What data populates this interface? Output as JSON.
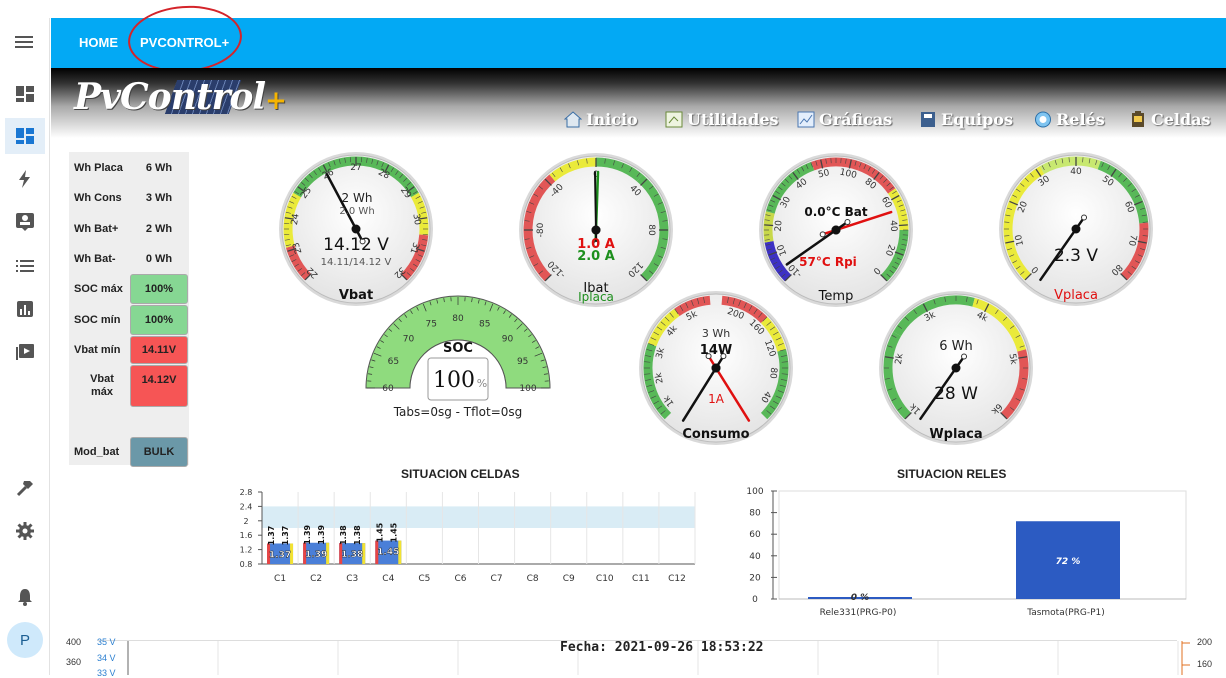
{
  "appbar": {
    "tabs": [
      {
        "label": "HOME"
      },
      {
        "label": "PVCONTROL+"
      }
    ]
  },
  "header": {
    "logo_text": "PvControl",
    "logo_plus": "+",
    "nav": [
      {
        "label": "Inicio",
        "icon": "home-icon"
      },
      {
        "label": "Utilidades",
        "icon": "utilities-icon"
      },
      {
        "label": "Gráficas",
        "icon": "charts-icon"
      },
      {
        "label": "Equipos",
        "icon": "equipment-icon"
      },
      {
        "label": "Relés",
        "icon": "relay-icon"
      },
      {
        "label": "Celdas",
        "icon": "cells-icon"
      }
    ]
  },
  "stats": [
    {
      "label": "Wh Placa",
      "value": "6 Wh"
    },
    {
      "label": "Wh Cons",
      "value": "3 Wh"
    },
    {
      "label": "Wh Bat+",
      "value": "2 Wh"
    },
    {
      "label": "Wh Bat-",
      "value": "0 Wh"
    },
    {
      "label": "SOC máx",
      "value": "100%",
      "color": "#86d793"
    },
    {
      "label": "SOC mín",
      "value": "100%",
      "color": "#86d793"
    },
    {
      "label": "Vbat mín",
      "value": "14.11V",
      "color": "#f65555"
    },
    {
      "label": "Vbat máx",
      "value": "14.12V",
      "color": "#f65555"
    },
    {
      "label": "Mod_bat",
      "value": "BULK",
      "color": "#6b98a8"
    }
  ],
  "gauges": {
    "vbat": {
      "title": "Vbat",
      "top": "2 Wh",
      "top2": "2.0 Wh",
      "value": "14.12 V",
      "sub": "14.11/14.12 V",
      "ticks": [
        "22",
        "23",
        "24",
        "25",
        "26",
        "27",
        "28",
        "29",
        "30",
        "31",
        "32"
      ]
    },
    "ibat": {
      "title": "Ibat",
      "title2": "Iplaca",
      "v1": "1.0 A",
      "v2": "2.0 A",
      "ticks": [
        "-120",
        "-80",
        "-40",
        "0",
        "40",
        "80",
        "120"
      ]
    },
    "temp": {
      "title": "Temp",
      "v1": "0.0°C Bat",
      "v2": "57°C Rpi",
      "ticks": [
        "-10",
        "10",
        "20",
        "30",
        "40",
        "50",
        "100",
        "80",
        "60",
        "40",
        "20",
        "0"
      ]
    },
    "vplaca": {
      "title": "Vplaca",
      "value": "2.3 V",
      "ticks": [
        "0",
        "10",
        "20",
        "30",
        "40",
        "50",
        "60",
        "70",
        "80"
      ]
    },
    "soc": {
      "title": "SOC",
      "value": "100",
      "unit": "%",
      "ticks": [
        "60",
        "65",
        "70",
        "75",
        "80",
        "85",
        "90",
        "95",
        "100"
      ],
      "footer": "Tabs=0sg - Tflot=0sg"
    },
    "consumo": {
      "title": "Consumo",
      "top": "3 Wh",
      "value": "14W",
      "v2": "1A",
      "ticks": [
        "1k",
        "2k",
        "3k",
        "4k",
        "5k",
        "200",
        "160",
        "120",
        "80",
        "40"
      ]
    },
    "wplaca": {
      "title": "Wplaca",
      "top": "6 Wh",
      "value": "28 W",
      "ticks": [
        "1k",
        "2k",
        "3k",
        "4k",
        "5k",
        "6k"
      ]
    }
  },
  "celdas": {
    "title": "SITUACION CELDAS",
    "chart_data": {
      "type": "bar",
      "categories": [
        "C1",
        "C2",
        "C3",
        "C4",
        "C5",
        "C6",
        "C7",
        "C8",
        "C9",
        "C10",
        "C11",
        "C12"
      ],
      "values": [
        1.37,
        1.39,
        1.38,
        1.45,
        null,
        null,
        null,
        null,
        null,
        null,
        null,
        null
      ],
      "max_labels": [
        "1.37",
        "1.37",
        "1.39",
        "1.39",
        "1.38",
        "1.38",
        "1.45",
        "1.45"
      ],
      "ylim": [
        0.8,
        2.8
      ],
      "yticks": [
        "2.8",
        "2.4",
        "2",
        "1.6",
        "1.2",
        "0.8"
      ],
      "band": [
        1.8,
        2.4
      ]
    }
  },
  "reles": {
    "title": "SITUACION RELES",
    "chart_data": {
      "type": "bar",
      "categories": [
        "Rele331(PRG-P0)",
        "Tasmota(PRG-P1)"
      ],
      "values": [
        0,
        72
      ],
      "labels": [
        "0 %",
        "72 %"
      ],
      "ylim": [
        0,
        100
      ],
      "yticks": [
        "100",
        "80",
        "60",
        "40",
        "20",
        "0"
      ]
    }
  },
  "footer": {
    "fecha": "Fecha: 2021-09-26 18:53:22",
    "left_axis": [
      "400",
      "360"
    ],
    "left_axis2": [
      "35 V",
      "34 V",
      "33 V"
    ],
    "right_axis": [
      "200",
      "160"
    ]
  }
}
